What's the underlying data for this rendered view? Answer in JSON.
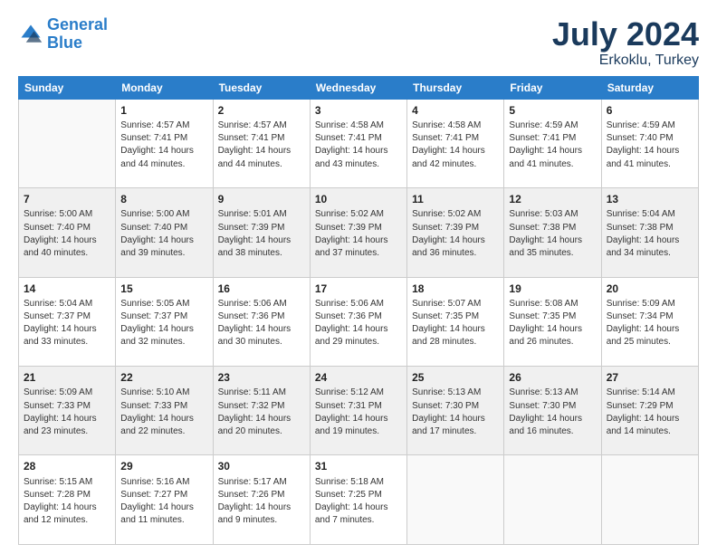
{
  "logo": {
    "line1": "General",
    "line2": "Blue"
  },
  "title": "July 2024",
  "location": "Erkoklu, Turkey",
  "days_header": [
    "Sunday",
    "Monday",
    "Tuesday",
    "Wednesday",
    "Thursday",
    "Friday",
    "Saturday"
  ],
  "weeks": [
    [
      {
        "day": "",
        "sunrise": "",
        "sunset": "",
        "daylight": ""
      },
      {
        "day": "1",
        "sunrise": "Sunrise: 4:57 AM",
        "sunset": "Sunset: 7:41 PM",
        "daylight": "Daylight: 14 hours and 44 minutes."
      },
      {
        "day": "2",
        "sunrise": "Sunrise: 4:57 AM",
        "sunset": "Sunset: 7:41 PM",
        "daylight": "Daylight: 14 hours and 44 minutes."
      },
      {
        "day": "3",
        "sunrise": "Sunrise: 4:58 AM",
        "sunset": "Sunset: 7:41 PM",
        "daylight": "Daylight: 14 hours and 43 minutes."
      },
      {
        "day": "4",
        "sunrise": "Sunrise: 4:58 AM",
        "sunset": "Sunset: 7:41 PM",
        "daylight": "Daylight: 14 hours and 42 minutes."
      },
      {
        "day": "5",
        "sunrise": "Sunrise: 4:59 AM",
        "sunset": "Sunset: 7:41 PM",
        "daylight": "Daylight: 14 hours and 41 minutes."
      },
      {
        "day": "6",
        "sunrise": "Sunrise: 4:59 AM",
        "sunset": "Sunset: 7:40 PM",
        "daylight": "Daylight: 14 hours and 41 minutes."
      }
    ],
    [
      {
        "day": "7",
        "sunrise": "Sunrise: 5:00 AM",
        "sunset": "Sunset: 7:40 PM",
        "daylight": "Daylight: 14 hours and 40 minutes."
      },
      {
        "day": "8",
        "sunrise": "Sunrise: 5:00 AM",
        "sunset": "Sunset: 7:40 PM",
        "daylight": "Daylight: 14 hours and 39 minutes."
      },
      {
        "day": "9",
        "sunrise": "Sunrise: 5:01 AM",
        "sunset": "Sunset: 7:39 PM",
        "daylight": "Daylight: 14 hours and 38 minutes."
      },
      {
        "day": "10",
        "sunrise": "Sunrise: 5:02 AM",
        "sunset": "Sunset: 7:39 PM",
        "daylight": "Daylight: 14 hours and 37 minutes."
      },
      {
        "day": "11",
        "sunrise": "Sunrise: 5:02 AM",
        "sunset": "Sunset: 7:39 PM",
        "daylight": "Daylight: 14 hours and 36 minutes."
      },
      {
        "day": "12",
        "sunrise": "Sunrise: 5:03 AM",
        "sunset": "Sunset: 7:38 PM",
        "daylight": "Daylight: 14 hours and 35 minutes."
      },
      {
        "day": "13",
        "sunrise": "Sunrise: 5:04 AM",
        "sunset": "Sunset: 7:38 PM",
        "daylight": "Daylight: 14 hours and 34 minutes."
      }
    ],
    [
      {
        "day": "14",
        "sunrise": "Sunrise: 5:04 AM",
        "sunset": "Sunset: 7:37 PM",
        "daylight": "Daylight: 14 hours and 33 minutes."
      },
      {
        "day": "15",
        "sunrise": "Sunrise: 5:05 AM",
        "sunset": "Sunset: 7:37 PM",
        "daylight": "Daylight: 14 hours and 32 minutes."
      },
      {
        "day": "16",
        "sunrise": "Sunrise: 5:06 AM",
        "sunset": "Sunset: 7:36 PM",
        "daylight": "Daylight: 14 hours and 30 minutes."
      },
      {
        "day": "17",
        "sunrise": "Sunrise: 5:06 AM",
        "sunset": "Sunset: 7:36 PM",
        "daylight": "Daylight: 14 hours and 29 minutes."
      },
      {
        "day": "18",
        "sunrise": "Sunrise: 5:07 AM",
        "sunset": "Sunset: 7:35 PM",
        "daylight": "Daylight: 14 hours and 28 minutes."
      },
      {
        "day": "19",
        "sunrise": "Sunrise: 5:08 AM",
        "sunset": "Sunset: 7:35 PM",
        "daylight": "Daylight: 14 hours and 26 minutes."
      },
      {
        "day": "20",
        "sunrise": "Sunrise: 5:09 AM",
        "sunset": "Sunset: 7:34 PM",
        "daylight": "Daylight: 14 hours and 25 minutes."
      }
    ],
    [
      {
        "day": "21",
        "sunrise": "Sunrise: 5:09 AM",
        "sunset": "Sunset: 7:33 PM",
        "daylight": "Daylight: 14 hours and 23 minutes."
      },
      {
        "day": "22",
        "sunrise": "Sunrise: 5:10 AM",
        "sunset": "Sunset: 7:33 PM",
        "daylight": "Daylight: 14 hours and 22 minutes."
      },
      {
        "day": "23",
        "sunrise": "Sunrise: 5:11 AM",
        "sunset": "Sunset: 7:32 PM",
        "daylight": "Daylight: 14 hours and 20 minutes."
      },
      {
        "day": "24",
        "sunrise": "Sunrise: 5:12 AM",
        "sunset": "Sunset: 7:31 PM",
        "daylight": "Daylight: 14 hours and 19 minutes."
      },
      {
        "day": "25",
        "sunrise": "Sunrise: 5:13 AM",
        "sunset": "Sunset: 7:30 PM",
        "daylight": "Daylight: 14 hours and 17 minutes."
      },
      {
        "day": "26",
        "sunrise": "Sunrise: 5:13 AM",
        "sunset": "Sunset: 7:30 PM",
        "daylight": "Daylight: 14 hours and 16 minutes."
      },
      {
        "day": "27",
        "sunrise": "Sunrise: 5:14 AM",
        "sunset": "Sunset: 7:29 PM",
        "daylight": "Daylight: 14 hours and 14 minutes."
      }
    ],
    [
      {
        "day": "28",
        "sunrise": "Sunrise: 5:15 AM",
        "sunset": "Sunset: 7:28 PM",
        "daylight": "Daylight: 14 hours and 12 minutes."
      },
      {
        "day": "29",
        "sunrise": "Sunrise: 5:16 AM",
        "sunset": "Sunset: 7:27 PM",
        "daylight": "Daylight: 14 hours and 11 minutes."
      },
      {
        "day": "30",
        "sunrise": "Sunrise: 5:17 AM",
        "sunset": "Sunset: 7:26 PM",
        "daylight": "Daylight: 14 hours and 9 minutes."
      },
      {
        "day": "31",
        "sunrise": "Sunrise: 5:18 AM",
        "sunset": "Sunset: 7:25 PM",
        "daylight": "Daylight: 14 hours and 7 minutes."
      },
      {
        "day": "",
        "sunrise": "",
        "sunset": "",
        "daylight": ""
      },
      {
        "day": "",
        "sunrise": "",
        "sunset": "",
        "daylight": ""
      },
      {
        "day": "",
        "sunrise": "",
        "sunset": "",
        "daylight": ""
      }
    ]
  ]
}
